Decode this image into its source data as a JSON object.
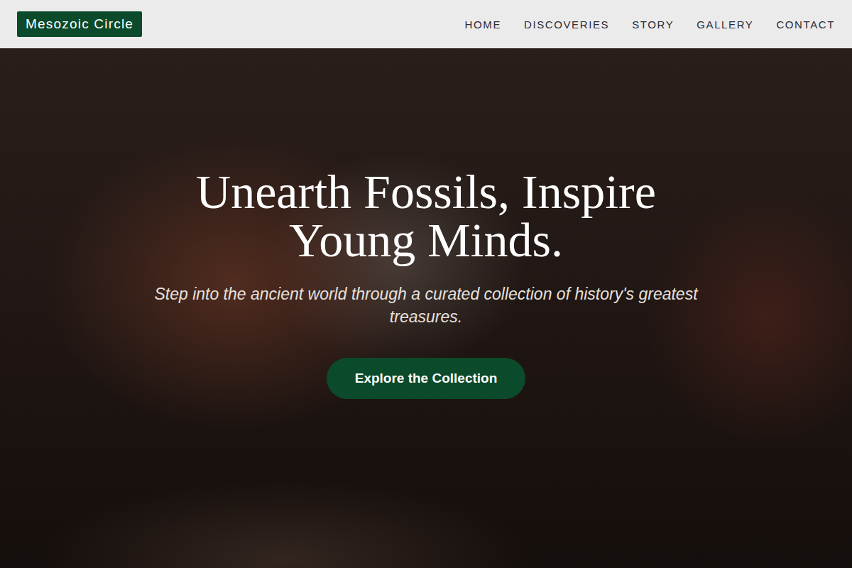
{
  "nav": {
    "logo": "Mesozoic Circle",
    "items": [
      {
        "label": "HOME"
      },
      {
        "label": "DISCOVERIES"
      },
      {
        "label": "STORY"
      },
      {
        "label": "GALLERY"
      },
      {
        "label": "CONTACT"
      }
    ]
  },
  "hero": {
    "title": "Unearth Fossils, Inspire Young Minds.",
    "subtitle": "Step into the ancient world through a curated collection of history's greatest treasures.",
    "button": "Explore the Collection"
  }
}
